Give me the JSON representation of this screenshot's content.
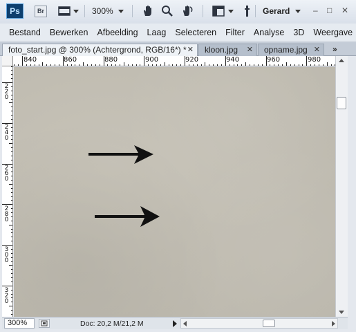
{
  "app": {
    "logo_text": "Ps",
    "bridge_text": "Br",
    "zoom_level": "300%",
    "workspace": "Gerard",
    "window_buttons": [
      "–",
      "□",
      "✕"
    ],
    "icons": [
      "film-strip-icon",
      "hand-tool-icon",
      "zoom-tool-icon",
      "rotate-view-icon",
      "arrange-documents-icon",
      "screen-mode-icon"
    ]
  },
  "menu": {
    "items": [
      "Bestand",
      "Bewerken",
      "Afbeelding",
      "Laag",
      "Selecteren",
      "Filter",
      "Analyse",
      "3D",
      "Weergave"
    ]
  },
  "tabs": {
    "items": [
      {
        "label": "foto_start.jpg @ 300% (Achtergrond, RGB/16*) *",
        "active": true
      },
      {
        "label": "kloon.jpg",
        "active": false
      },
      {
        "label": "opname.jpg",
        "active": false
      }
    ],
    "close": "✕",
    "overflow": "»"
  },
  "rulers": {
    "horizontal": [
      "840",
      "860",
      "880",
      "900",
      "920",
      "940",
      "960",
      "980"
    ],
    "vertical": [
      "220",
      "240",
      "260",
      "280",
      "300",
      "320"
    ]
  },
  "canvas": {
    "background_color": "#c1bdb2",
    "arrow_color": "#111111"
  },
  "status": {
    "zoom": "300%",
    "doc_info": "Doc: 20,2 M/21,2 M"
  }
}
